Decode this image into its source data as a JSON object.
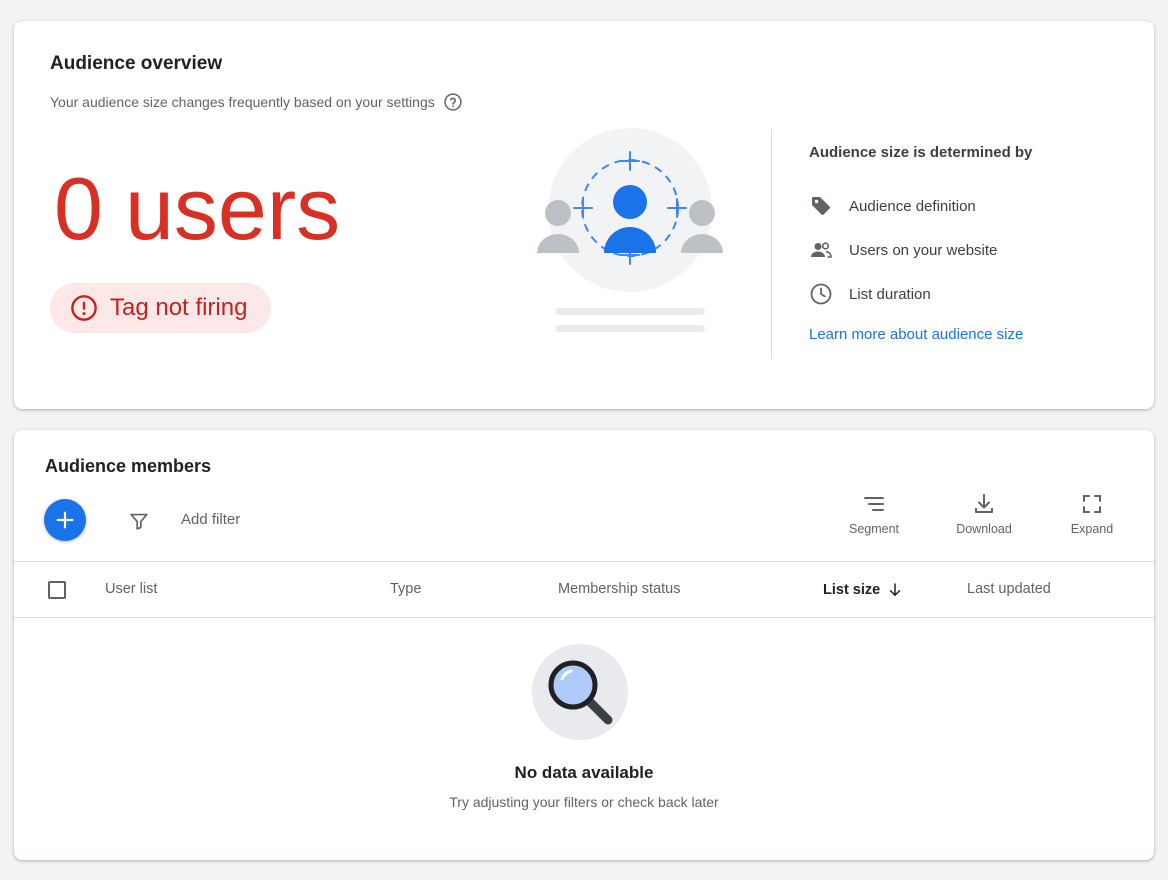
{
  "overview": {
    "title": "Audience overview",
    "subtitle": "Your audience size changes frequently based on your settings",
    "count_number": "0",
    "count_unit": "users",
    "status_chip": "Tag not firing",
    "determined_title": "Audience size is determined by",
    "determinants": [
      {
        "icon": "tag-icon",
        "label": "Audience definition"
      },
      {
        "icon": "people-icon",
        "label": "Users on your website"
      },
      {
        "icon": "clock-icon",
        "label": "List duration"
      }
    ],
    "learn_more": "Learn more about audience size"
  },
  "members": {
    "title": "Audience members",
    "add_filter": "Add filter",
    "tools": {
      "segment": "Segment",
      "download": "Download",
      "expand": "Expand"
    },
    "columns": {
      "user_list": "User list",
      "type": "Type",
      "membership_status": "Membership status",
      "list_size": "List size",
      "last_updated": "Last updated"
    },
    "empty_title": "No data available",
    "empty_subtitle": "Try adjusting your filters or check back later"
  },
  "colors": {
    "accent": "#1a73e8",
    "error": "#d93025",
    "error_bg": "#fce8e6",
    "background": "#f1f3f4"
  }
}
